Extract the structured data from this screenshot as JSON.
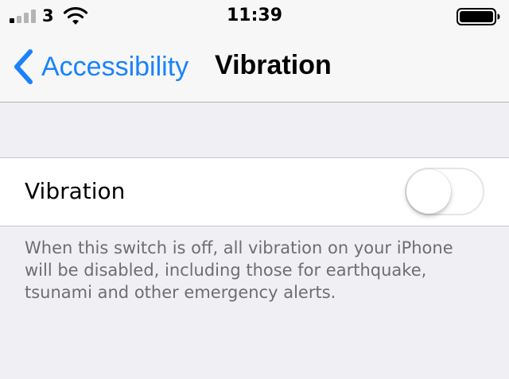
{
  "status_bar": {
    "carrier": "3",
    "time": "11:39",
    "signal_bars_active": 1,
    "signal_bars_total": 4
  },
  "nav": {
    "back_label": "Accessibility",
    "title": "Vibration"
  },
  "settings": {
    "vibration": {
      "label": "Vibration",
      "enabled": false
    },
    "footer": "When this switch is off, all vibration on your iPhone will be disabled, including those for earthquake, tsunami and other emergency alerts."
  },
  "icons": {
    "signal": "cellular-signal-icon",
    "wifi": "wifi-icon",
    "battery": "battery-icon",
    "back": "chevron-left-icon"
  },
  "colors": {
    "accent": "#1a82fb",
    "background": "#efeff4",
    "bar_background": "#f7f7f7",
    "footer_text": "#6d6d72",
    "signal_active": "#000000",
    "signal_inactive": "#b4b4b4"
  }
}
